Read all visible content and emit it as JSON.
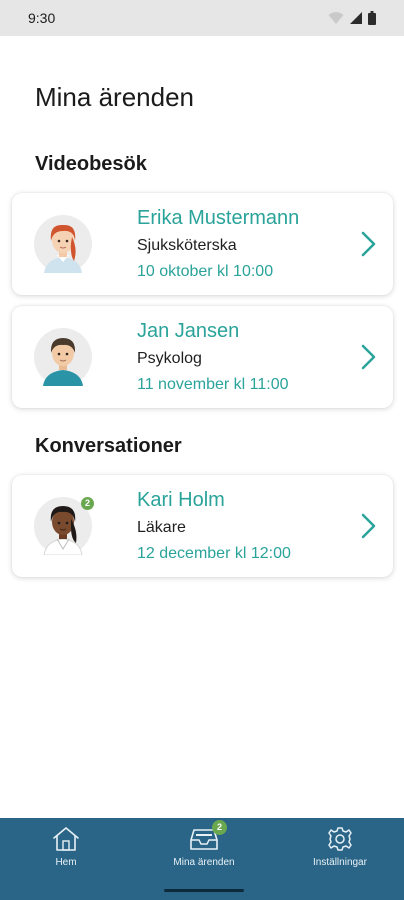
{
  "status_bar": {
    "time": "9:30"
  },
  "page_title": "Mina ärenden",
  "sections": {
    "video": {
      "heading": "Videobesök",
      "cards": [
        {
          "name": "Erika Mustermann",
          "role": "Sjuksköterska",
          "date": "10 oktober kl 10:00",
          "avatar": "female-nurse-avatar"
        },
        {
          "name": "Jan Jansen",
          "role": "Psykolog",
          "date": "11 november kl 11:00",
          "avatar": "male-psychologist-avatar"
        }
      ]
    },
    "conversations": {
      "heading": "Konversationer",
      "cards": [
        {
          "name": "Kari Holm",
          "role": "Läkare",
          "date": "12 december kl 12:00",
          "avatar": "female-doctor-avatar",
          "badge": "2"
        }
      ]
    }
  },
  "bottom_nav": {
    "items": [
      {
        "label": "Hem",
        "icon": "home-icon"
      },
      {
        "label": "Mina ärenden",
        "icon": "inbox-icon",
        "badge": "2"
      },
      {
        "label": "Inställningar",
        "icon": "gear-icon"
      }
    ]
  },
  "colors": {
    "accent": "#2aa39a",
    "nav_background": "#2a6587",
    "badge": "#6aa84f"
  }
}
